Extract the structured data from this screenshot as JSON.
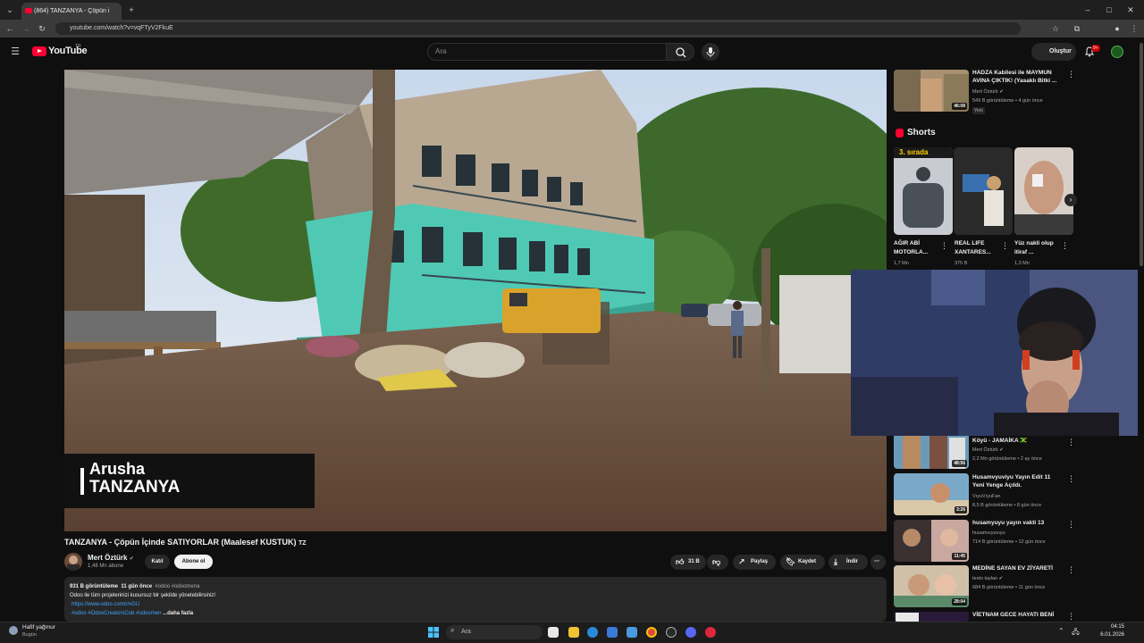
{
  "browser": {
    "tab_title": "(864) TANZANYA - Çöpün i",
    "url": "youtube.com/watch?v=vqFTyV2FkuE"
  },
  "header": {
    "logo": "YouTube",
    "region": "TR",
    "search_placeholder": "Ara",
    "create_label": "Oluştur",
    "notification_count": "9+"
  },
  "video": {
    "overlay_city": "Arusha",
    "overlay_country": "TANZANYA",
    "title": "TANZANYA - Çöpün İçinde SATIYORLAR (Maalesef KUSTUK)",
    "title_flag": "TZ"
  },
  "channel": {
    "name": "Mert Öztürk",
    "subscribers": "1,48 Mn abone",
    "join_label": "Katıl",
    "subscribe_label": "Abone ol"
  },
  "actions": {
    "likes": "31 B",
    "share": "Paylaş",
    "save": "Kaydet",
    "download": "İndir"
  },
  "description": {
    "views": "931 B görüntüleme",
    "age": "11 gün önce",
    "hashtags": "#odoo #odoomena",
    "line1": "Odoo ile tüm projelerinizi kusursuz bir şekilde yönetebilirsiniz!",
    "link": "https://www.odoo.com/r/xGU",
    "tags": "#odoo #OdooCreatorsCub #odoomen",
    "more": "...daha fazla"
  },
  "sidebar": {
    "top_video": {
      "title": "HADZA Kabilesi ile MAYMUN AVINA ÇIKTIK! (Yasaklı Bitki ...",
      "channel": "Mert Öztürk",
      "meta": "549 B görüntüleme • 4 gün önce",
      "badge": "Yeni",
      "duration": "46:08"
    },
    "shorts_heading": "Shorts",
    "shorts": [
      {
        "title": "AĞIR ABİ MOTORLA...",
        "views": "1,7 Mn",
        "overlay": "3. sırada"
      },
      {
        "title": "REAL LIFE XANTARES...",
        "views": "375 B",
        "overlay": ""
      },
      {
        "title": "Yüz nakli olup itiraf ...",
        "views": "1,3 Mn",
        "overlay": ""
      }
    ],
    "videos": [
      {
        "title": "Köyü - JAMAİKA 🇯🇲",
        "channel": "Mert Öztürk",
        "meta": "2,2 Mn görüntüleme • 2 ay önce",
        "duration": "48:56"
      },
      {
        "title": "Husamvyuviyu Yayın Edit 11 Yeni Yenge Açıldı.",
        "channel": "VıyuVıyuFan",
        "meta": "8,5 B görüntüleme • 8 gün önce",
        "duration": "3:26"
      },
      {
        "title": "husamyuyu yayın vakti 13",
        "channel": "husamvıyuvıyu",
        "meta": "714 B görüntüleme • 12 gün önce",
        "duration": "11:45"
      },
      {
        "title": "MEDİNE SAYAN EV ZİYARETİ",
        "channel": "testo taylan",
        "meta": "684 B görüntüleme • 11 gün önce",
        "duration": "28:04"
      },
      {
        "title": "VİETNAM GECE HAYATI BENİ",
        "channel": "",
        "meta": "",
        "duration": ""
      }
    ]
  },
  "taskbar": {
    "weather_title": "Hafif yağmur",
    "weather_sub": "Bugün",
    "search": "Ara",
    "time": "04:15",
    "date": "6.01.2026"
  }
}
